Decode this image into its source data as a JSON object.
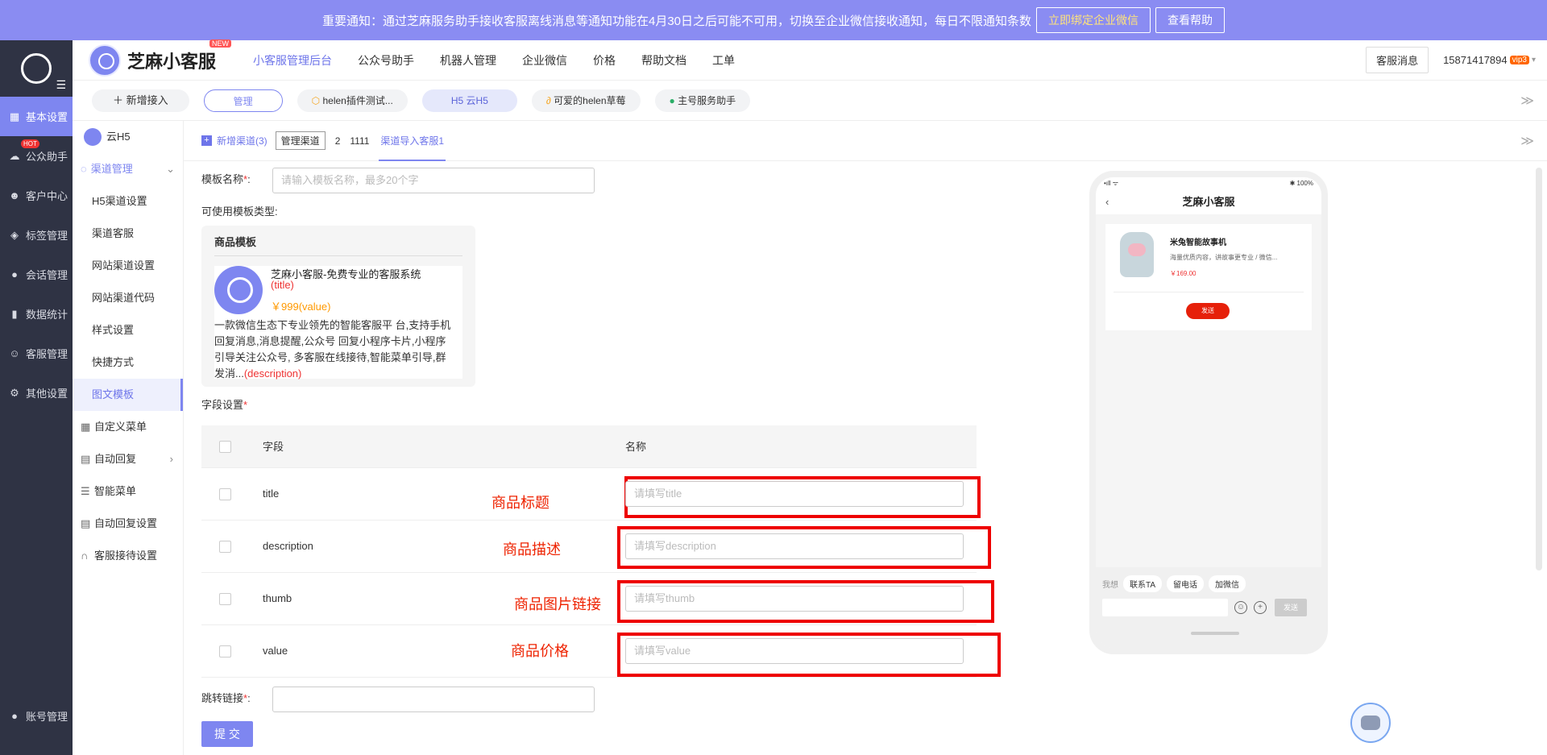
{
  "banner": {
    "text": "重要通知：通过芝麻服务助手接收客服离线消息等通知功能在4月30日之后可能不可用，切换至企业微信接收通知，每日不限通知条数",
    "bind_btn": "立即绑定企业微信",
    "help_btn": "查看帮助"
  },
  "leftnav": {
    "items": [
      {
        "label": "基本设置",
        "icon": "grid-icon"
      },
      {
        "label": "公众助手",
        "icon": "wechat-icon",
        "badge": "HOT"
      },
      {
        "label": "客户中心",
        "icon": "users-icon"
      },
      {
        "label": "标签管理",
        "icon": "tag-icon"
      },
      {
        "label": "会话管理",
        "icon": "chat-icon"
      },
      {
        "label": "数据统计",
        "icon": "bar-chart-icon"
      },
      {
        "label": "客服管理",
        "icon": "robot-icon"
      },
      {
        "label": "其他设置",
        "icon": "gear-icon"
      }
    ],
    "account": "账号管理"
  },
  "topbar": {
    "brand": "芝麻小客服",
    "new_badge": "NEW",
    "nav": [
      "小客服管理后台",
      "公众号助手",
      "机器人管理",
      "企业微信",
      "价格",
      "帮助文档",
      "工单"
    ],
    "msg_btn": "客服消息",
    "phone": "15871417894",
    "vip": "vip3"
  },
  "chanbar": {
    "add": "新增接入",
    "manage": "管理",
    "chips": [
      "helen插件测试...",
      "H5 云H5",
      "可爱的helen草莓",
      "主号服务助手"
    ]
  },
  "sidemenu": {
    "channel": "云H5",
    "group": "渠道管理",
    "sub": [
      "H5渠道设置",
      "渠道客服",
      "网站渠道设置",
      "网站渠道代码",
      "样式设置",
      "快捷方式",
      "图文模板"
    ],
    "others": [
      "自定义菜单",
      "自动回复",
      "智能菜单",
      "自动回复设置",
      "客服接待设置"
    ]
  },
  "tabs": {
    "add": "新增渠道(3)",
    "manage": "管理渠道",
    "items": [
      "2",
      "1111",
      "渠道导入客服1"
    ]
  },
  "form": {
    "template_name_label": "模板名称",
    "template_name_placeholder": "请输入模板名称，最多20个字",
    "available_types": "可使用模板类型:",
    "card": {
      "title": "商品模板",
      "name": "芝麻小客服-免费专业的客服系统",
      "name_tag": "(title)",
      "price": "￥999(value)",
      "desc": "一款微信生态下专业领先的智能客服平 台,支持手机回复消息,消息提醒,公众号 回复小程序卡片,小程序引导关注公众号, 多客服在线接待,智能菜单引导,群发消...",
      "desc_tag": "(description)"
    },
    "fields_label": "字段设置",
    "table_headers": [
      "字段",
      "名称"
    ],
    "rows": [
      {
        "field": "title",
        "placeholder": "请填写title",
        "annotation": "商品标题"
      },
      {
        "field": "description",
        "placeholder": "请填写description",
        "annotation": "商品描述"
      },
      {
        "field": "thumb",
        "placeholder": "请填写thumb",
        "annotation": "商品图片链接"
      },
      {
        "field": "value",
        "placeholder": "请填写value",
        "annotation": "商品价格"
      }
    ],
    "link_label": "跳转链接",
    "submit": "提 交"
  },
  "phone": {
    "status_left": "•ıll ᯤ",
    "status_right": "✱ 100%",
    "title": "芝麻小客服",
    "product": "米兔智能故事机",
    "product_desc": "海量优质内容，讲故事更专业 / 微信...",
    "product_price": "￥169.00",
    "send": "发送",
    "quick_label": "我想",
    "quick": [
      "联系TA",
      "留电话",
      "加微信"
    ],
    "send_btn": "发送"
  },
  "colors": {
    "accent": "#7e86f0",
    "banner": "#8a8cf2",
    "sidebar": "#2f3344",
    "annotation": "#e00000"
  }
}
